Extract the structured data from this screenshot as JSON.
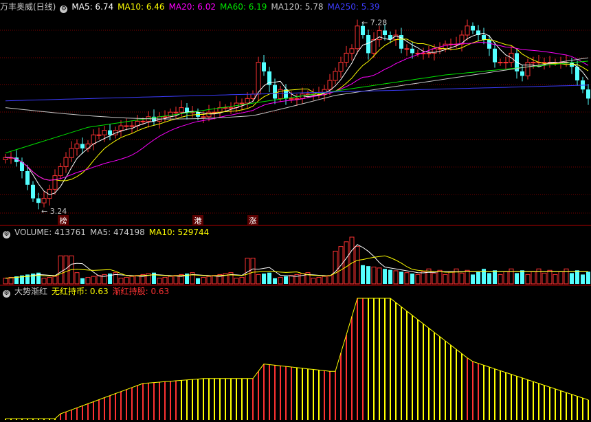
{
  "colors": {
    "up": "#ff3232",
    "down": "#54ffff",
    "ma5": "#ffffff",
    "ma10": "#ffff00",
    "ma20": "#ff00ff",
    "ma60": "#00e600",
    "ma120": "#c8c8c8",
    "ma250": "#3c3cff",
    "grid": "#7a0000",
    "sep": "#b40000"
  },
  "price_panel": {
    "title": "万丰奥威(日线)",
    "ma_labels": [
      {
        "text": "MA5: 6.74",
        "color": "#ffffff"
      },
      {
        "text": "MA10: 6.46",
        "color": "#ffff00"
      },
      {
        "text": "MA20: 6.02",
        "color": "#ff00ff"
      },
      {
        "text": "MA60: 6.19",
        "color": "#00e600"
      },
      {
        "text": "MA120: 5.78",
        "color": "#c8c8c8"
      },
      {
        "text": "MA250: 5.39",
        "color": "#3c3cff"
      }
    ],
    "high_label": "7.28",
    "low_label": "3.24",
    "markers": [
      "榜",
      "港",
      "涨"
    ]
  },
  "volume_panel": {
    "labels": [
      {
        "text": "VOLUME: 413761",
        "color": "#c8c8c8"
      },
      {
        "text": "MA5: 474198",
        "color": "#c8c8c8"
      },
      {
        "text": "MA10: 529744",
        "color": "#ffff00"
      }
    ]
  },
  "indicator_panel": {
    "title": "大势渐红",
    "labels": [
      {
        "text": "无红持币: 0.63",
        "color": "#ffff00"
      },
      {
        "text": "渐红持股: 0.63",
        "color": "#ff3232"
      }
    ]
  },
  "chart_data": [
    {
      "type": "candlestick",
      "name_label": "万丰奥威(日线)",
      "ylim": [
        3.0,
        7.5
      ],
      "bars": 107,
      "key_points": [
        {
          "index": 6,
          "close": 3.24,
          "note": "low 3.24"
        },
        {
          "index": 64,
          "close": 7.28,
          "note": "high 7.28"
        }
      ],
      "close_shape": [
        4.3,
        4.3,
        4.2,
        4.0,
        3.7,
        3.4,
        3.3,
        3.4,
        3.6,
        3.9,
        4.1,
        4.3,
        4.5,
        4.6,
        4.5,
        4.6,
        4.8,
        4.8,
        4.9,
        4.8,
        4.9,
        5.0,
        5.0,
        5.0,
        5.1,
        5.1,
        5.2,
        5.1,
        5.2,
        5.2,
        5.3,
        5.3,
        5.4,
        5.3,
        5.3,
        5.2,
        5.2,
        5.3,
        5.3,
        5.4,
        5.4,
        5.4,
        5.5,
        5.5,
        5.6,
        5.7,
        6.4,
        6.2,
        5.9,
        5.6,
        5.8,
        5.6,
        5.6,
        5.6,
        5.7,
        5.7,
        5.7,
        5.7,
        5.8,
        6.0,
        6.2,
        6.4,
        6.6,
        6.7,
        7.2,
        7.0,
        6.6,
        6.9,
        7.1,
        7.0,
        6.9,
        7.0,
        6.7,
        6.7,
        6.6,
        6.6,
        6.6,
        6.6,
        6.7,
        6.7,
        6.8,
        6.8,
        6.8,
        7.0,
        7.2,
        7.1,
        7.0,
        6.9,
        6.7,
        6.4,
        6.4,
        6.4,
        6.6,
        6.2,
        6.1,
        6.4,
        6.4,
        6.4,
        6.4,
        6.4,
        6.4,
        6.4,
        6.4,
        6.3,
        6.0,
        5.8,
        5.6
      ]
    },
    {
      "type": "bar",
      "name": "VOLUME",
      "series_labels": [
        "VOLUME: 413761",
        "MA5: 474198",
        "MA10: 529744"
      ]
    },
    {
      "type": "bar",
      "name": "大势渐红",
      "series_labels": [
        "无红持币: 0.63",
        "渐红持股: 0.63"
      ],
      "ylim": [
        0,
        1
      ],
      "note": "Bars colored red (渐红持股) or yellow (无红持币)"
    }
  ]
}
